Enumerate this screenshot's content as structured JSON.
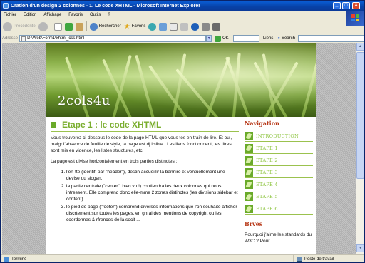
{
  "window": {
    "title": "Cration d'un design 2 colonnes - 1. Le code XHTML - Microsoft Internet Explorer",
    "min": "_",
    "max": "□",
    "close": "×"
  },
  "menu": [
    "Fichier",
    "Edition",
    "Affichage",
    "Favoris",
    "Outils",
    "?"
  ],
  "toolbar": {
    "back": "Précédente",
    "search": "Rechercher",
    "favorites": "Favoris"
  },
  "address": {
    "label": "Adresse",
    "value": "D:\\Web\\Form1\\xhtml_css.html",
    "go": "OK",
    "links": "Liens",
    "search_label": "Search"
  },
  "page": {
    "brand": "2cols4u",
    "heading": "Etape 1 : le code XHTML",
    "intro": "Vous trouverez ci-dessous le code de la page HTML que vous tes en train de lire. Et oui, malgr l'absence de feuille de style, la page est dj lisible ! Les liens fonctionnent, les titres sont mis en vidence, les listes structures, etc.",
    "split_intro": "La page est divise horizontalement en trois parties distinctes :",
    "list": [
      "l'en-tte (identifi par \"header\"), destin accueillir la bannire et ventuellement une devise ou slogan.",
      "la partie centrale (\"center\", bien vu !) contiendra les deux colonnes qui nous intressent. Elle comprend donc elle-mme 2 zones distinctes (les divisions sidebar et content).",
      "le pied de page (\"footer\") comprend diverses informations que l'on souhaite afficher discrtement sur toutes les pages, en gnral des mentions de copyright ou les coordonnes & rfrences de la socit ..."
    ]
  },
  "sidebar": {
    "nav_title": "Navigation",
    "items": [
      "INTRODUCTION",
      "ETAPE 1",
      "ETAPE 2",
      "ETAPE 3",
      "ETAPE 4",
      "ETAPE 5",
      "ETAPE 6"
    ],
    "breves_title": "Brves",
    "breves_text": "Pourquoi j'aime les standards du W3C ? Pour"
  },
  "status": {
    "left": "Terminé",
    "right": "Poste de travail"
  },
  "colors": {
    "accent_green": "#7aae2e",
    "nav_link": "#8bc33c",
    "sidebar_title": "#b83a1a",
    "title_bar": "#0a5fd8"
  }
}
